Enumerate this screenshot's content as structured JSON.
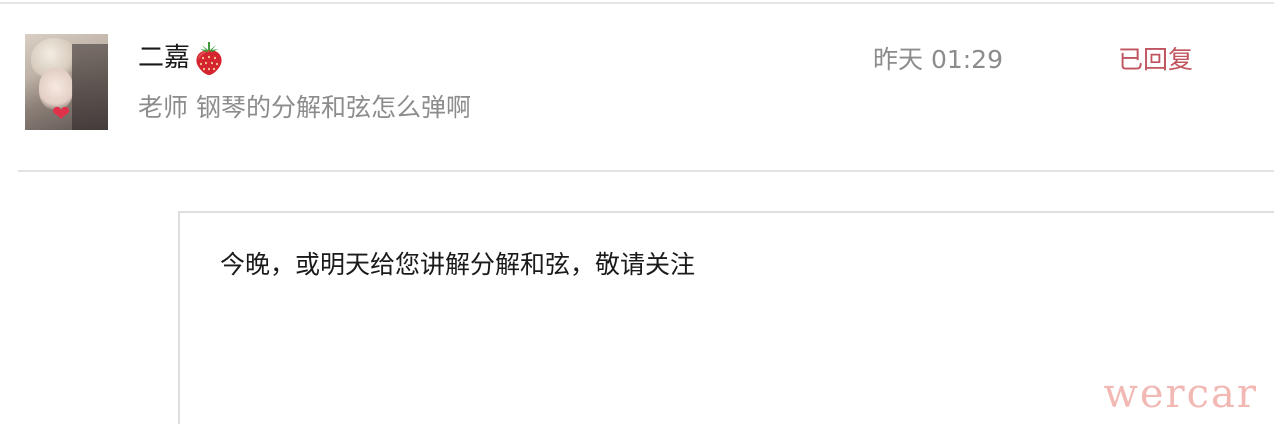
{
  "message": {
    "username": "二嘉",
    "username_emoji": "strawberry-icon",
    "preview": "老师 钢琴的分解和弦怎么弹啊",
    "timestamp": "昨天 01:29",
    "status": "已回复",
    "avatar_badge": "heart-icon"
  },
  "reply": {
    "text": "今晚，或明天给您讲解分解和弦，敬请关注"
  },
  "watermark": {
    "text": "wercar"
  },
  "colors": {
    "status": "#c0555f",
    "secondary_text": "#8c8c8c",
    "primary_text": "#1a1a1a",
    "watermark": "#f2b8b4",
    "divider": "#e3e3e3"
  }
}
